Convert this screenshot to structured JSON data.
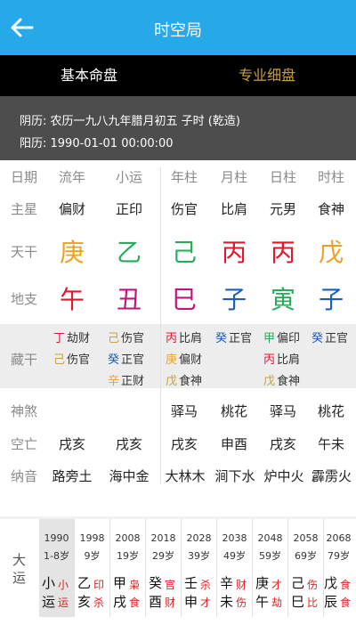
{
  "header": {
    "title": "时空局"
  },
  "tabs": [
    {
      "label": "基本命盘"
    },
    {
      "label": "专业细盘"
    }
  ],
  "info": {
    "line1": "阴历: 农历一九八九年腊月初五  子时  (乾造)",
    "line2": "阳历: 1990-01-01 00:00:00"
  },
  "columns": [
    "日期",
    "流年",
    "小运",
    "年柱",
    "月柱",
    "日柱",
    "时柱"
  ],
  "rows": {
    "zhuxing": {
      "label": "主星",
      "values": [
        "偏财",
        "正印",
        "伤官",
        "比肩",
        "元男",
        "食神"
      ]
    },
    "tiangan": {
      "label": "天干",
      "values": [
        "庚",
        "乙",
        "己",
        "丙",
        "丙",
        "戊"
      ]
    },
    "dizhi": {
      "label": "地支",
      "values": [
        "午",
        "丑",
        "巳",
        "子",
        "寅",
        "子"
      ]
    },
    "canggan": {
      "label": "藏干",
      "liunian": [
        {
          "s": "丁",
          "god": "劫财"
        },
        {
          "s": "己",
          "god": "伤官"
        }
      ],
      "xiaoyun": [
        {
          "s": "己",
          "god": "伤官"
        },
        {
          "s": "癸",
          "god": "正官"
        },
        {
          "s": "辛",
          "god": "正财"
        }
      ],
      "nianzhu": [
        {
          "s": "丙",
          "god": "比肩"
        },
        {
          "s": "庚",
          "god": "偏财"
        },
        {
          "s": "戊",
          "god": "食神"
        }
      ],
      "yuezhu": [
        {
          "s": "癸",
          "god": "正官"
        }
      ],
      "rizhu": [
        {
          "s": "甲",
          "god": "偏印"
        },
        {
          "s": "丙",
          "god": "比肩"
        },
        {
          "s": "戊",
          "god": "食神"
        }
      ],
      "shizhu": [
        {
          "s": "癸",
          "god": "正官"
        }
      ]
    },
    "shensha": {
      "label": "神煞",
      "values": [
        "驿马",
        "桃花",
        "驿马",
        "桃花"
      ]
    },
    "kongwang": {
      "label": "空亡",
      "values": [
        "戌亥",
        "戌亥",
        "戌亥",
        "申酉",
        "戌亥",
        "午未"
      ]
    },
    "nayin": {
      "label": "纳音",
      "values": [
        "路旁土",
        "海中金",
        "大林木",
        "涧下水",
        "炉中火",
        "霹雳火"
      ]
    }
  },
  "dayun": {
    "label": "大运",
    "periods": [
      {
        "year": "1990",
        "age": "1-8岁",
        "g": "小",
        "z": "运",
        "sg": "小",
        "sz": "运"
      },
      {
        "year": "1998",
        "age": "9岁",
        "g": "乙",
        "z": "亥",
        "sg": "印",
        "sz": "杀"
      },
      {
        "year": "2008",
        "age": "19岁",
        "g": "甲",
        "z": "戌",
        "sg": "枭",
        "sz": "食"
      },
      {
        "year": "2018",
        "age": "29岁",
        "g": "癸",
        "z": "酉",
        "sg": "官",
        "sz": "财"
      },
      {
        "year": "2028",
        "age": "39岁",
        "g": "壬",
        "z": "申",
        "sg": "杀",
        "sz": "才"
      },
      {
        "year": "2038",
        "age": "49岁",
        "g": "辛",
        "z": "未",
        "sg": "财",
        "sz": "伤"
      },
      {
        "year": "2048",
        "age": "59岁",
        "g": "庚",
        "z": "午",
        "sg": "才",
        "sz": "劫"
      },
      {
        "year": "2058",
        "age": "69岁",
        "g": "己",
        "z": "巳",
        "sg": "伤",
        "sz": "比"
      },
      {
        "year": "2068",
        "age": "79岁",
        "g": "戊",
        "z": "辰",
        "sg": "食",
        "sz": "食"
      }
    ]
  },
  "colors": {
    "header": "#27a8e8",
    "tab_active": "#ffffff",
    "tab_inactive": "#c9a03c",
    "info_bg": "#4d4d4d",
    "accent_red": "#e02020"
  }
}
